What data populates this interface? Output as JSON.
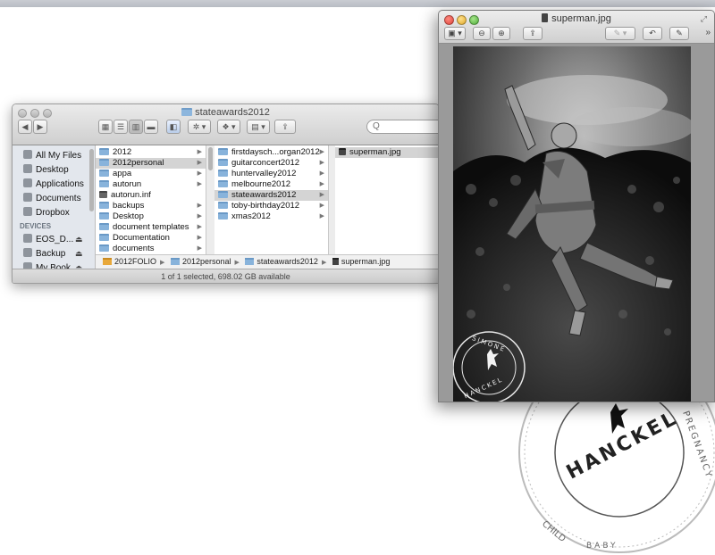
{
  "finder": {
    "title": "stateawards2012",
    "search_placeholder": "Q",
    "sidebar": {
      "favorites": [
        {
          "label": "All My Files",
          "icon": "all-files-icon"
        },
        {
          "label": "Desktop",
          "icon": "desktop-icon"
        },
        {
          "label": "Applications",
          "icon": "applications-icon"
        },
        {
          "label": "Documents",
          "icon": "documents-icon"
        },
        {
          "label": "Dropbox",
          "icon": "dropbox-icon"
        }
      ],
      "devices_header": "DEVICES",
      "devices": [
        {
          "label": "EOS_D...",
          "icon": "disk-icon"
        },
        {
          "label": "Backup",
          "icon": "time-machine-icon"
        },
        {
          "label": "My Book",
          "icon": "external-drive-icon"
        }
      ]
    },
    "columns": [
      {
        "items": [
          {
            "label": "2012",
            "type": "folder",
            "selected": false
          },
          {
            "label": "2012personal",
            "type": "folder",
            "selected": true
          },
          {
            "label": "appa",
            "type": "folder",
            "selected": false
          },
          {
            "label": "autorun",
            "type": "folder",
            "selected": false
          },
          {
            "label": "autorun.inf",
            "type": "doc",
            "selected": false
          },
          {
            "label": "backups",
            "type": "folder",
            "selected": false
          },
          {
            "label": "Desktop",
            "type": "folder",
            "selected": false
          },
          {
            "label": "document templates",
            "type": "folder",
            "selected": false
          },
          {
            "label": "Documentation",
            "type": "folder",
            "selected": false
          },
          {
            "label": "documents",
            "type": "folder",
            "selected": false
          }
        ]
      },
      {
        "items": [
          {
            "label": "firstdaysch...organ2012",
            "type": "folder",
            "selected": false
          },
          {
            "label": "guitarconcert2012",
            "type": "folder",
            "selected": false
          },
          {
            "label": "huntervalley2012",
            "type": "folder",
            "selected": false
          },
          {
            "label": "melbourne2012",
            "type": "folder",
            "selected": false
          },
          {
            "label": "stateawards2012",
            "type": "folder",
            "selected": true
          },
          {
            "label": "toby-birthday2012",
            "type": "folder",
            "selected": false
          },
          {
            "label": "xmas2012",
            "type": "folder",
            "selected": false
          }
        ]
      },
      {
        "items": [
          {
            "label": "superman.jpg",
            "type": "image",
            "selected": true
          }
        ]
      }
    ],
    "path": [
      "2012FOLIO",
      "2012personal",
      "stateawards2012",
      "superman.jpg"
    ],
    "status": "1 of 1 selected, 698.02 GB available"
  },
  "preview": {
    "title": "superman.jpg",
    "toolbar": {
      "sidebar_icon": "sidebar-toggle-icon",
      "zoom_out_icon": "zoom-out-icon",
      "zoom_in_icon": "zoom-in-icon",
      "share_icon": "share-icon",
      "annotate_icon": "pen-icon",
      "rotate_icon": "rotate-icon",
      "edit_icon": "edit-toolbar-icon"
    }
  },
  "photo_watermark": {
    "line1": "SIMONE",
    "line2": "HANCKEL"
  },
  "seal": {
    "name": "HANCKEL",
    "ring_words": [
      "CHILD",
      "BABY",
      "PREGNANCY"
    ]
  }
}
